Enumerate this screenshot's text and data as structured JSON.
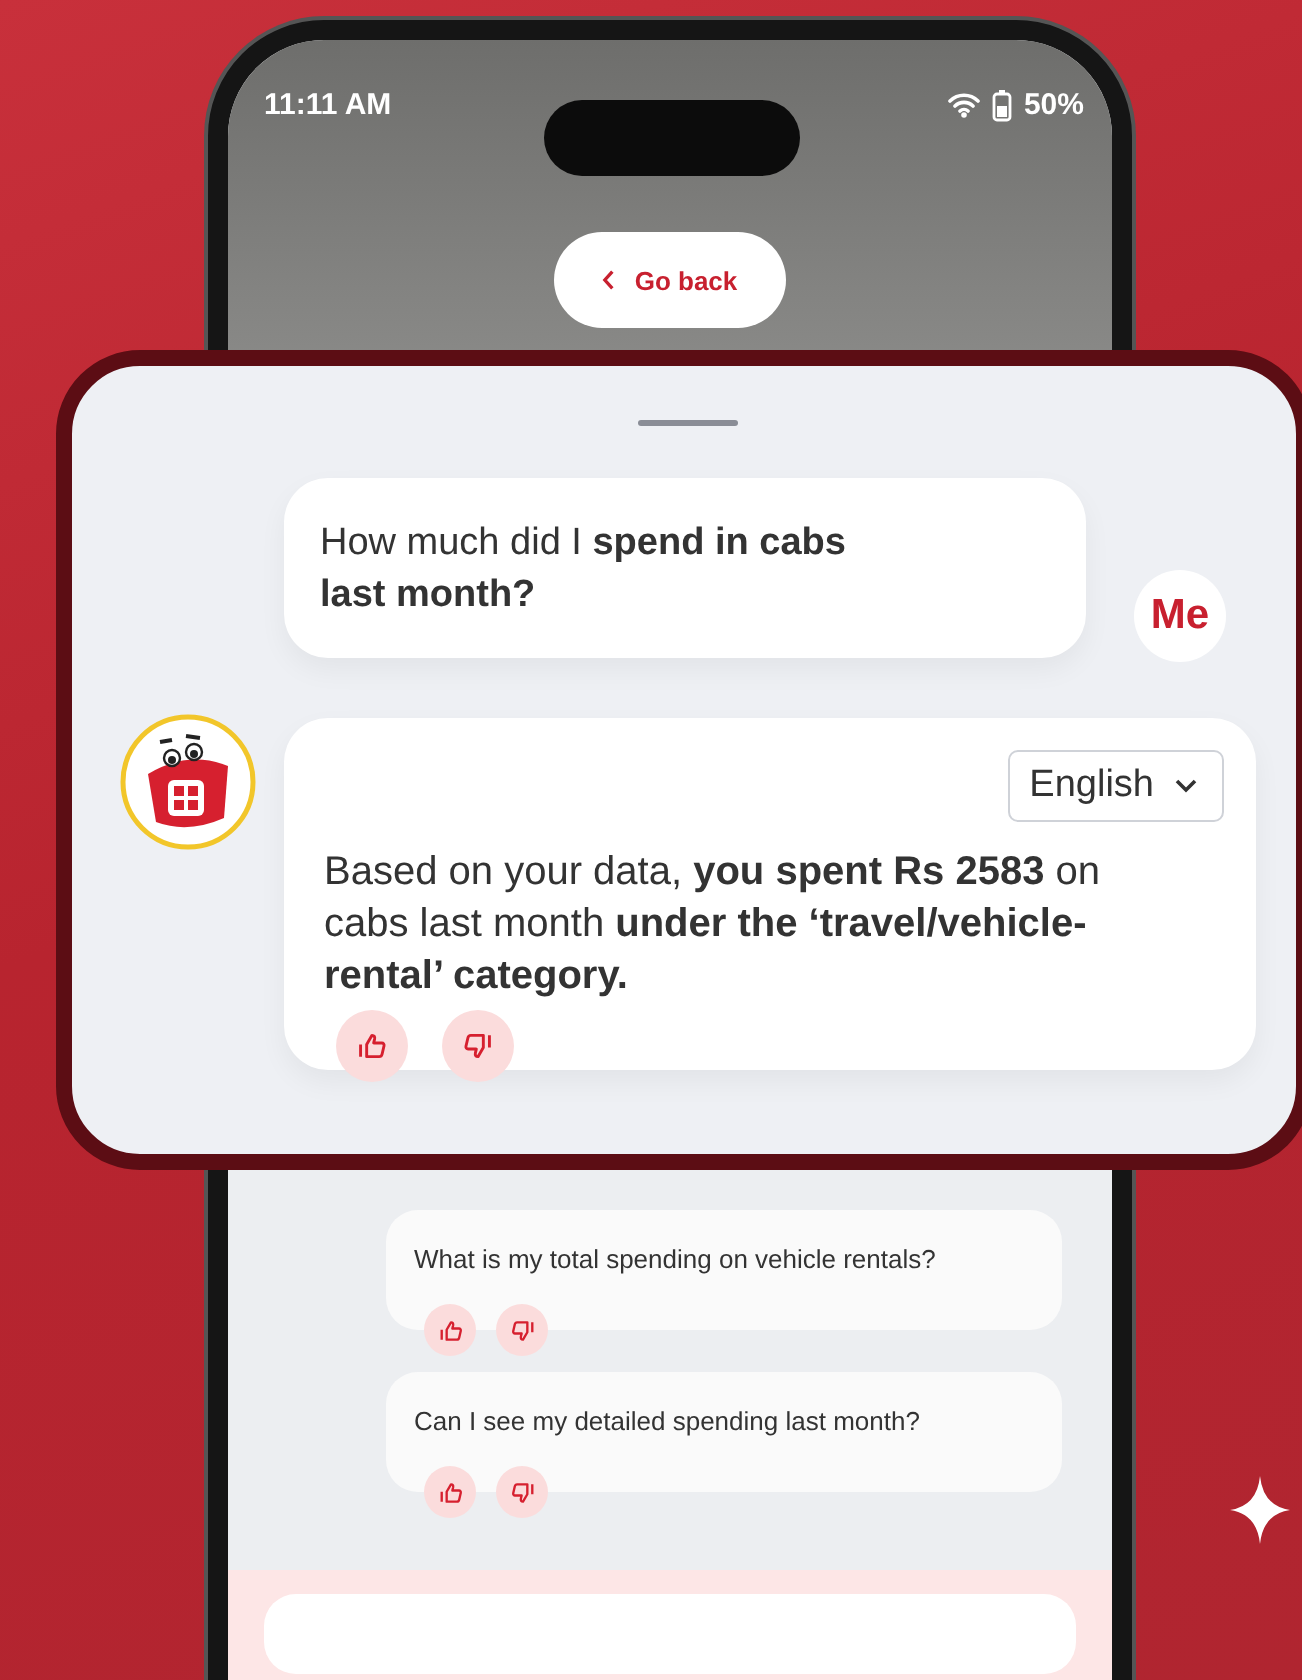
{
  "status_bar": {
    "time": "11:11 AM",
    "battery": "50%"
  },
  "back_button": {
    "label": "Go back"
  },
  "conversation": {
    "question": {
      "text": "How much did I **spend in cabs last month?**",
      "sender": "Me"
    },
    "answer": {
      "language": "English",
      "text": "Based on your data, **you spent Rs 2583** on cabs last month **under the ‘travel/vehicle-rental’ category.**"
    }
  },
  "suggestions": [
    {
      "text": "What is my total spending on vehicle rentals?"
    },
    {
      "text": "Can I see my detailed spending last month?"
    }
  ]
}
